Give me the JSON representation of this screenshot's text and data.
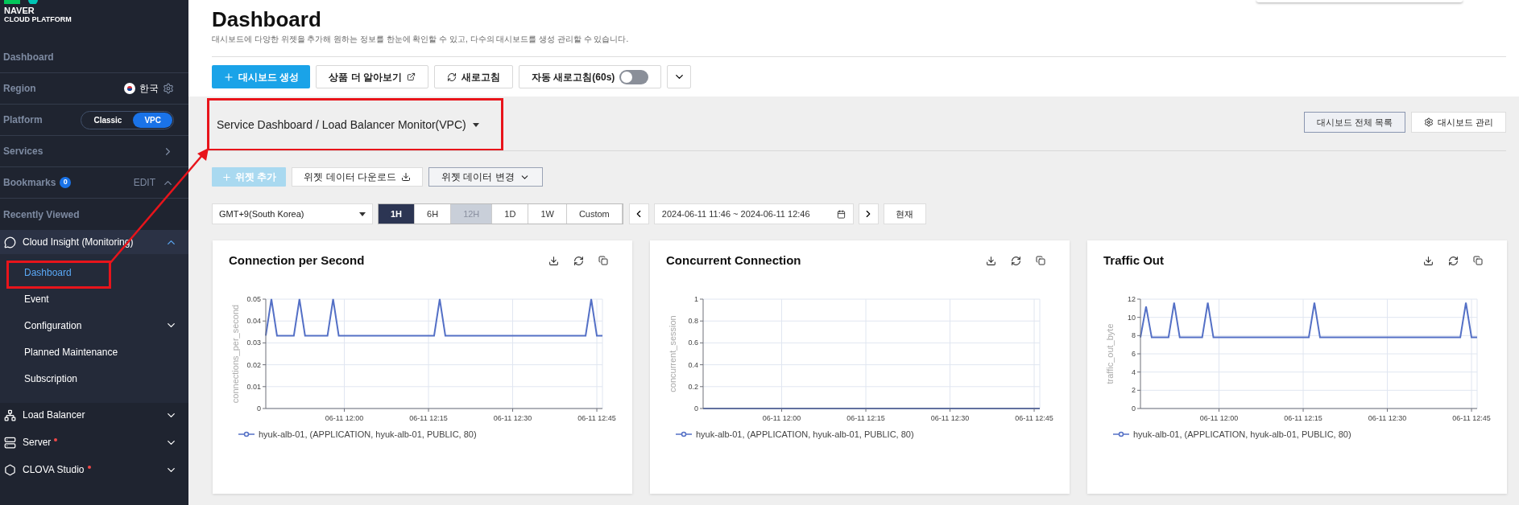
{
  "sidebar": {
    "brand": [
      "NAVER",
      "CLOUD PLATFORM"
    ],
    "dashboard_link": "Dashboard",
    "region": {
      "label": "Region",
      "value": "한국"
    },
    "platform": {
      "label": "Platform",
      "options": [
        {
          "label": "Classic",
          "selected": false
        },
        {
          "label": "VPC",
          "selected": true
        }
      ]
    },
    "services": {
      "label": "Services"
    },
    "bookmarks": {
      "label": "Bookmarks",
      "count": "0",
      "edit": "EDIT",
      "expanded": true
    },
    "recently_viewed": "Recently Viewed",
    "menus": [
      {
        "label": "Cloud Insight (Monitoring)",
        "expanded": true,
        "new": false,
        "children": [
          {
            "label": "Dashboard",
            "selected": true,
            "kind": "link"
          },
          {
            "label": "Event",
            "selected": false,
            "kind": "link"
          },
          {
            "label": "Configuration",
            "selected": false,
            "kind": "group",
            "expanded": false
          },
          {
            "label": "Planned Maintenance",
            "selected": false,
            "kind": "link"
          },
          {
            "label": "Subscription",
            "selected": false,
            "kind": "link"
          }
        ]
      },
      {
        "label": "Load Balancer",
        "expanded": false,
        "new": false
      },
      {
        "label": "Server",
        "expanded": false,
        "new": true
      },
      {
        "label": "CLOVA Studio",
        "expanded": false,
        "new": true
      }
    ]
  },
  "header": {
    "title": "Dashboard",
    "subtitle": "대시보드에 다양한 위젯을 추가해 원하는 정보를 한눈에 확인할 수 있고, 다수의 대시보드를 생성 관리할 수 있습니다."
  },
  "actions": [
    {
      "label": "대시보드 생성",
      "kind": "primary"
    },
    {
      "label": "상품 더 알아보기",
      "kind": "external"
    },
    {
      "label": "새로고침",
      "kind": "refresh"
    },
    {
      "label": "자동 새로고침(60s)",
      "kind": "toggle",
      "on": false
    },
    {
      "kind": "more"
    }
  ],
  "dashboard_bar": {
    "selector": "Service Dashboard / Load Balancer Monitor(VPC)",
    "buttons": [
      {
        "label": "대시보드 전체 목록",
        "kind": "list"
      },
      {
        "label": "대시보드 관리",
        "kind": "settings"
      }
    ]
  },
  "widget_actions": [
    {
      "label": "위젯 추가",
      "kind": "add",
      "disabled": true
    },
    {
      "label": "위젯 데이터 다운로드",
      "kind": "download",
      "disabled": false
    },
    {
      "label": "위젯 데이터 변경",
      "kind": "dropdown",
      "disabled": false
    }
  ],
  "time": {
    "timezone": "GMT+9(South Korea)",
    "ranges": [
      {
        "label": "1H",
        "selected": true,
        "disabled": false
      },
      {
        "label": "6H",
        "selected": false,
        "disabled": false
      },
      {
        "label": "12H",
        "selected": false,
        "disabled": true
      },
      {
        "label": "1D",
        "selected": false,
        "disabled": false
      },
      {
        "label": "1W",
        "selected": false,
        "disabled": false
      },
      {
        "label": "Custom",
        "selected": false,
        "disabled": false
      }
    ],
    "date_range": "2024-06-11 11:46 ~ 2024-06-11 12:46",
    "now_button": "현재"
  },
  "widgets": [
    {
      "title": "Connection per Second",
      "chart_data": {
        "type": "line",
        "grid": true,
        "ylabel": "connections_per_second",
        "ylim": [
          0,
          0.05
        ],
        "yticks": [
          0,
          0.01,
          0.02,
          0.03,
          0.04,
          0.05
        ],
        "categories": [
          null,
          null,
          null,
          null,
          null,
          null,
          null,
          null,
          null,
          null,
          null,
          null,
          null,
          null,
          "06-11 12:00",
          null,
          null,
          null,
          null,
          null,
          null,
          null,
          null,
          null,
          null,
          null,
          null,
          null,
          null,
          "06-11 12:15",
          null,
          null,
          null,
          null,
          null,
          null,
          null,
          null,
          null,
          null,
          null,
          null,
          null,
          null,
          "06-11 12:30",
          null,
          null,
          null,
          null,
          null,
          null,
          null,
          null,
          null,
          null,
          null,
          null,
          null,
          null,
          "06-11 12:45",
          null
        ],
        "series": [
          {
            "name": "hyuk-alb-01, (APPLICATION, hyuk-alb-01, PUBLIC, 80)",
            "color": "#5470c6",
            "values": [
              0.0333,
              0.05,
              0.0333,
              0.0333,
              0.0333,
              0.0333,
              0.05,
              0.0333,
              0.0333,
              0.0333,
              0.0333,
              0.0333,
              0.05,
              0.0333,
              0.0333,
              0.0333,
              0.0333,
              0.0333,
              0.0333,
              0.0333,
              0.0333,
              0.0333,
              0.0333,
              0.0333,
              0.0333,
              0.0333,
              0.0333,
              0.0333,
              0.0333,
              0.0333,
              0.0333,
              0.05,
              0.0333,
              0.0333,
              0.0333,
              0.0333,
              0.0333,
              0.0333,
              0.0333,
              0.0333,
              0.0333,
              0.0333,
              0.0333,
              0.0333,
              0.0333,
              0.0333,
              0.0333,
              0.0333,
              0.0333,
              0.0333,
              0.0333,
              0.0333,
              0.0333,
              0.0333,
              0.0333,
              0.0333,
              0.0333,
              0.0333,
              0.05,
              0.0333,
              0.0333
            ]
          }
        ]
      }
    },
    {
      "title": "Concurrent Connection",
      "chart_data": {
        "type": "line",
        "grid": true,
        "ylabel": "concurrent_session",
        "ylim": [
          0,
          1
        ],
        "yticks": [
          0,
          0.2,
          0.4,
          0.6,
          0.8,
          1
        ],
        "categories": [
          null,
          null,
          null,
          null,
          null,
          null,
          null,
          null,
          null,
          null,
          null,
          null,
          null,
          null,
          "06-11 12:00",
          null,
          null,
          null,
          null,
          null,
          null,
          null,
          null,
          null,
          null,
          null,
          null,
          null,
          null,
          "06-11 12:15",
          null,
          null,
          null,
          null,
          null,
          null,
          null,
          null,
          null,
          null,
          null,
          null,
          null,
          null,
          "06-11 12:30",
          null,
          null,
          null,
          null,
          null,
          null,
          null,
          null,
          null,
          null,
          null,
          null,
          null,
          null,
          "06-11 12:45",
          null
        ],
        "series": [
          {
            "name": "hyuk-alb-01, (APPLICATION, hyuk-alb-01, PUBLIC, 80)",
            "color": "#5470c6",
            "values": [
              0,
              0,
              0,
              0,
              0,
              0,
              0,
              0,
              0,
              0,
              0,
              0,
              0,
              0,
              0,
              0,
              0,
              0,
              0,
              0,
              0,
              0,
              0,
              0,
              0,
              0,
              0,
              0,
              0,
              0,
              0,
              0,
              0,
              0,
              0,
              0,
              0,
              0,
              0,
              0,
              0,
              0,
              0,
              0,
              0,
              0,
              0,
              0,
              0,
              0,
              0,
              0,
              0,
              0,
              0,
              0,
              0,
              0,
              0,
              0,
              0
            ]
          }
        ]
      }
    },
    {
      "title": "Traffic Out",
      "chart_data": {
        "type": "line",
        "grid": true,
        "ylabel": "traffic_out_byte",
        "ylim": [
          0,
          12
        ],
        "yticks": [
          0,
          2,
          4,
          6,
          8,
          10,
          12
        ],
        "categories": [
          null,
          null,
          null,
          null,
          null,
          null,
          null,
          null,
          null,
          null,
          null,
          null,
          null,
          null,
          "06-11 12:00",
          null,
          null,
          null,
          null,
          null,
          null,
          null,
          null,
          null,
          null,
          null,
          null,
          null,
          null,
          "06-11 12:15",
          null,
          null,
          null,
          null,
          null,
          null,
          null,
          null,
          null,
          null,
          null,
          null,
          null,
          null,
          "06-11 12:30",
          null,
          null,
          null,
          null,
          null,
          null,
          null,
          null,
          null,
          null,
          null,
          null,
          null,
          null,
          "06-11 12:45",
          null
        ],
        "series": [
          {
            "name": "hyuk-alb-01, (APPLICATION, hyuk-alb-01, PUBLIC, 80)",
            "color": "#5470c6",
            "values": [
              7.8,
              11.2,
              7.8,
              7.8,
              7.8,
              7.8,
              11.6,
              7.8,
              7.8,
              7.8,
              7.8,
              7.8,
              11.6,
              7.8,
              7.8,
              7.8,
              7.8,
              7.8,
              7.8,
              7.8,
              7.8,
              7.8,
              7.8,
              7.8,
              7.8,
              7.8,
              7.8,
              7.8,
              7.8,
              7.8,
              7.8,
              11.6,
              7.8,
              7.8,
              7.8,
              7.8,
              7.8,
              7.8,
              7.8,
              7.8,
              7.8,
              7.8,
              7.8,
              7.8,
              7.8,
              7.8,
              7.8,
              7.8,
              7.8,
              7.8,
              7.8,
              7.8,
              7.8,
              7.8,
              7.8,
              7.8,
              7.8,
              7.8,
              11.6,
              7.8,
              7.8
            ]
          }
        ]
      }
    }
  ]
}
